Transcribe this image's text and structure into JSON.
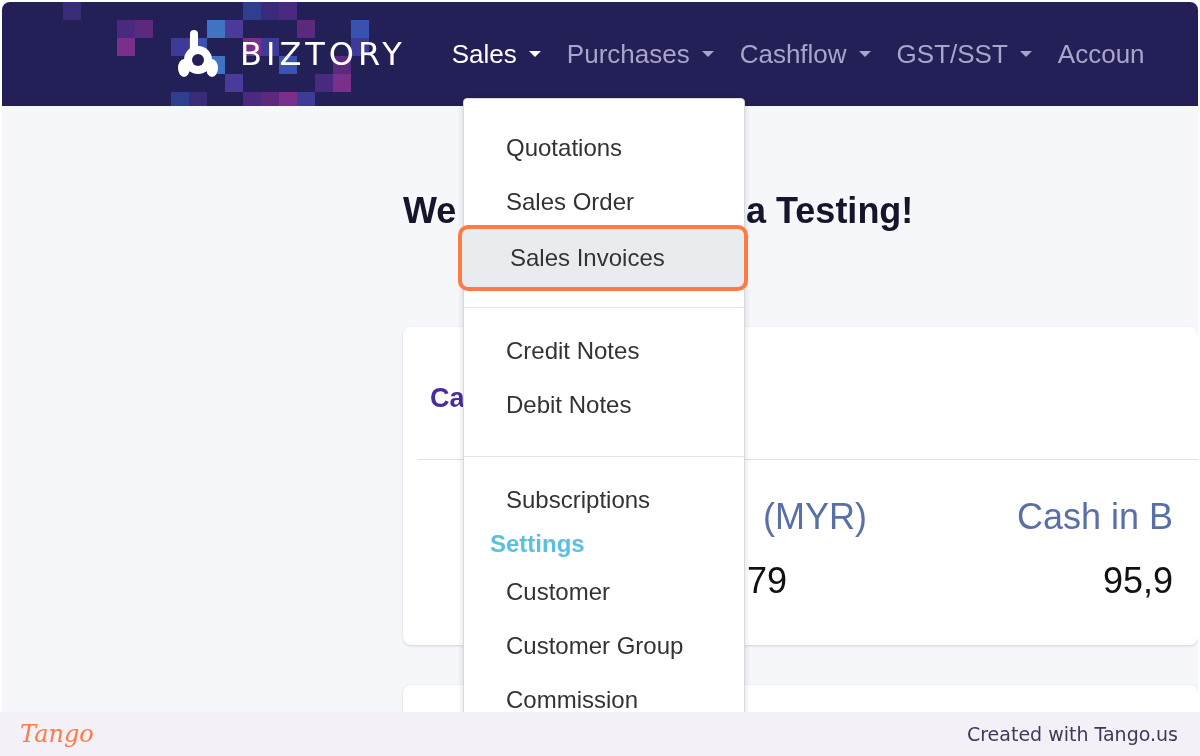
{
  "nav": {
    "logo": "BIZTORY",
    "menus": [
      {
        "label": "Sales",
        "selected": true,
        "caret": true
      },
      {
        "label": "Purchases",
        "selected": false,
        "caret": true
      },
      {
        "label": "Cashflow",
        "selected": false,
        "caret": true
      },
      {
        "label": "GST/SST",
        "selected": false,
        "caret": true
      },
      {
        "label": "Accoun",
        "selected": false,
        "caret": false
      }
    ]
  },
  "dropdown": {
    "items": [
      {
        "kind": "item",
        "label": "Quotations",
        "selected": false
      },
      {
        "kind": "item",
        "label": "Sales Order",
        "selected": false
      },
      {
        "kind": "item",
        "label": "Sales Invoices",
        "selected": true
      },
      {
        "kind": "divider"
      },
      {
        "kind": "item",
        "label": "Credit Notes",
        "selected": false
      },
      {
        "kind": "item",
        "label": "Debit Notes",
        "selected": false
      },
      {
        "kind": "divider"
      },
      {
        "kind": "item",
        "label": "Subscriptions",
        "selected": false
      },
      {
        "kind": "header",
        "label": "Settings"
      },
      {
        "kind": "item",
        "label": "Customer",
        "selected": false
      },
      {
        "kind": "item",
        "label": "Customer Group",
        "selected": false
      },
      {
        "kind": "item",
        "label": "Commission",
        "selected": false
      }
    ]
  },
  "content": {
    "heading_start": "We",
    "heading_end": "a Testing!",
    "card": {
      "title": "Ca",
      "stats": [
        {
          "label": "(MYR)",
          "value": "79"
        },
        {
          "label": "Cash in B",
          "value": "95,9"
        }
      ]
    }
  },
  "footer": {
    "logo": "Tango",
    "credit": "Created with Tango.us"
  }
}
